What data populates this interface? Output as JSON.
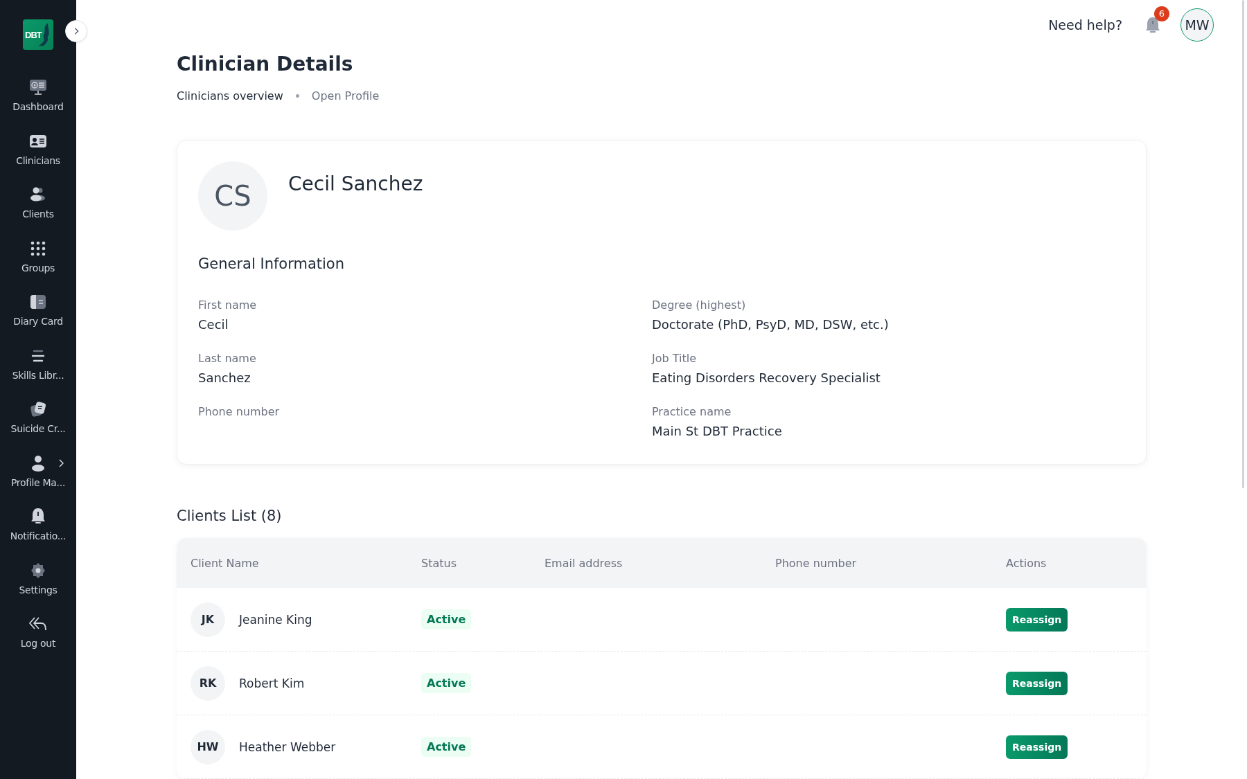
{
  "sidebar": {
    "logo": "DBT",
    "items": [
      {
        "label": "Dashboard",
        "has_submenu": false
      },
      {
        "label": "Clinicians",
        "has_submenu": false
      },
      {
        "label": "Clients",
        "has_submenu": false
      },
      {
        "label": "Groups",
        "has_submenu": false
      },
      {
        "label": "Diary Card",
        "has_submenu": false
      },
      {
        "label": "Skills Libr...",
        "has_submenu": false
      },
      {
        "label": "Suicide Cr...",
        "has_submenu": false
      },
      {
        "label": "Profile Ma...",
        "has_submenu": true
      },
      {
        "label": "Notificatio...",
        "has_submenu": false
      },
      {
        "label": "Settings",
        "has_submenu": false
      },
      {
        "label": "Log out",
        "has_submenu": false
      }
    ]
  },
  "header": {
    "help": "Need help?",
    "notification_count": "6",
    "user_initials": "MW"
  },
  "page": {
    "title": "Clinician Details",
    "breadcrumbs": [
      {
        "label": "Clinicians overview",
        "selected": false
      },
      {
        "label": "Open Profile",
        "selected": true
      }
    ]
  },
  "profile": {
    "initials": "CS",
    "name": "Cecil Sanchez",
    "section_title": "General Information",
    "fields": [
      {
        "label": "First name",
        "value": "Cecil"
      },
      {
        "label": "Degree (highest)",
        "value": "Doctorate (PhD, PsyD, MD, DSW, etc.)"
      },
      {
        "label": "Last name",
        "value": "Sanchez"
      },
      {
        "label": "Job Title",
        "value": "Eating Disorders Recovery Specialist"
      },
      {
        "label": "Phone number"
      },
      {
        "label": "Practice name",
        "value": "Main St DBT Practice"
      }
    ]
  },
  "clients": {
    "title": "Clients List (8)",
    "columns": [
      "Client Name",
      "Status",
      "Email address",
      "Phone number",
      "Actions"
    ],
    "rows": [
      {
        "initials": "JK",
        "name": "Jeanine King",
        "status": "Active",
        "action": "Reassign"
      },
      {
        "initials": "RK",
        "name": "Robert Kim",
        "status": "Active",
        "action": "Reassign"
      },
      {
        "initials": "HW",
        "name": "Heather Webber",
        "status": "Active",
        "action": "Reassign"
      }
    ]
  }
}
